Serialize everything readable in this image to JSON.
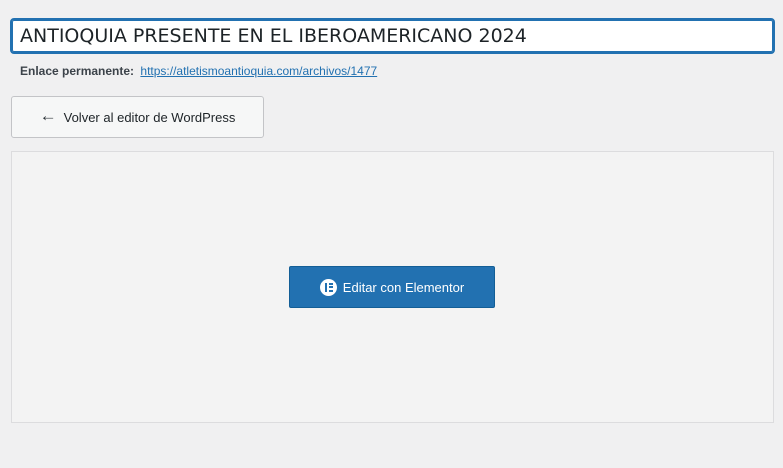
{
  "post_title": {
    "value": "ANTIOQUIA PRESENTE EN EL IBEROAMERICANO 2024"
  },
  "permalink": {
    "label": "Enlace permanente:",
    "url_text": "https://atletismoantioquia.com/archivos/1477"
  },
  "back_button": {
    "label": "Volver al editor de WordPress",
    "icon": "arrow-left-icon"
  },
  "elementor_button": {
    "label": "Editar con Elementor",
    "icon": "elementor-logo-icon"
  },
  "colors": {
    "accent": "#2271b1",
    "background": "#f0f0f1",
    "panel": "#f3f3f3"
  }
}
